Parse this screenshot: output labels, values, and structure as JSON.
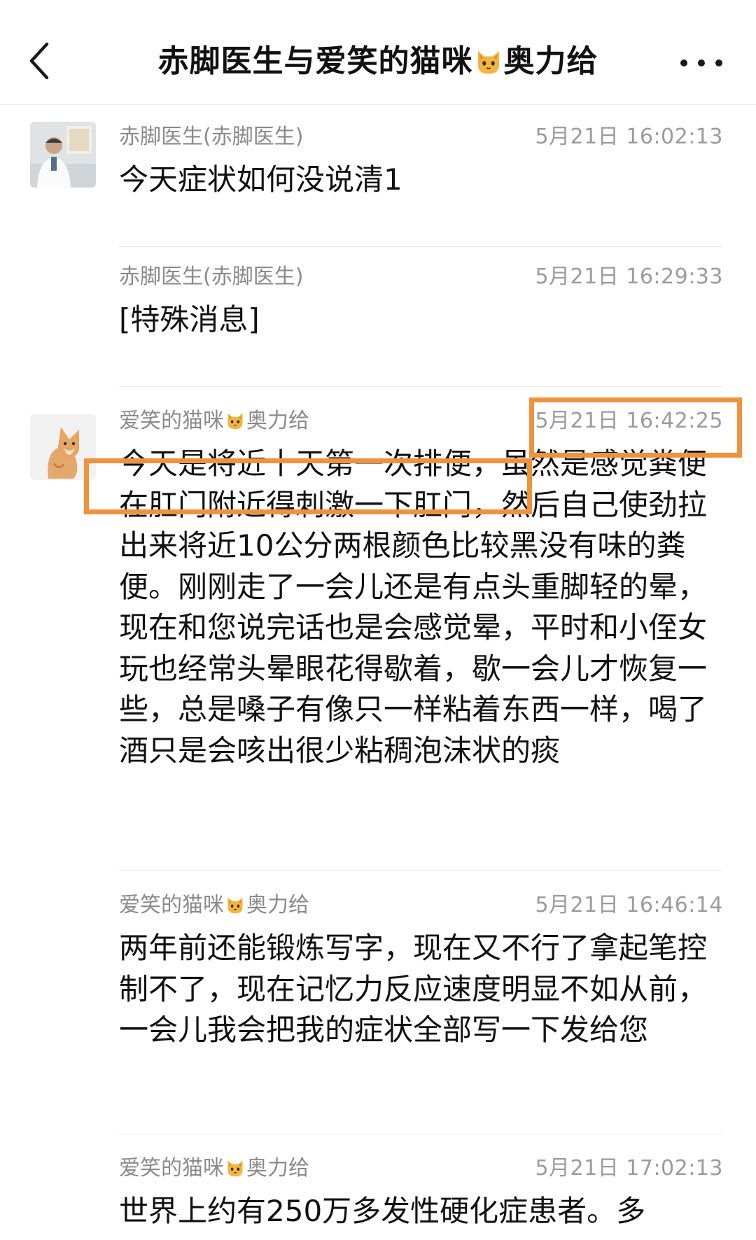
{
  "header": {
    "title_part1": "赤脚医生与爱笑的猫咪",
    "title_emoji": "cat-emoji-icon",
    "title_part2": "奥力给"
  },
  "messages": [
    {
      "sender": "赤脚医生(赤脚医生)",
      "time": "5月21日 16:02:13",
      "text": "今天症状如何没说清1",
      "avatar": "doctor-avatar"
    },
    {
      "sender": "赤脚医生(赤脚医生)",
      "time": "5月21日 16:29:33",
      "text": "[特殊消息]"
    },
    {
      "sender_part1": "爱笑的猫咪",
      "sender_part2": "奥力给",
      "time": "5月21日 16:42:25",
      "text": "今天是将近十天第一次排便，虽然是感觉粪便在肛门附近得刺激一下肛门，然后自己使劲拉出来将近10公分两根颜色比较黑没有味的粪便。刚刚走了一会儿还是有点头重脚轻的晕，现在和您说完话也是会感觉晕，平时和小侄女玩也经常头晕眼花得歇着，歇一会儿才恢复一些，总是嗓子有像只一样粘着东西一样，喝了酒只是会咳出很少粘稠泡沫状的痰",
      "avatar": "cat-avatar"
    },
    {
      "sender_part1": "爱笑的猫咪",
      "sender_part2": "奥力给",
      "time": "5月21日 16:46:14",
      "text": " 两年前还能锻炼写字，现在又不行了拿起笔控制不了，现在记忆力反应速度明显不如从前，一会儿我会把我的症状全部写一下发给您"
    },
    {
      "sender_part1": "爱笑的猫咪",
      "sender_part2": "奥力给",
      "time": "5月21日 17:02:13",
      "text": "世界上约有250万多发性硬化症患者。多"
    }
  ],
  "colors": {
    "highlight": "#f0923c",
    "meta_text": "#8a8a8a",
    "divider": "#e6e6e6"
  }
}
